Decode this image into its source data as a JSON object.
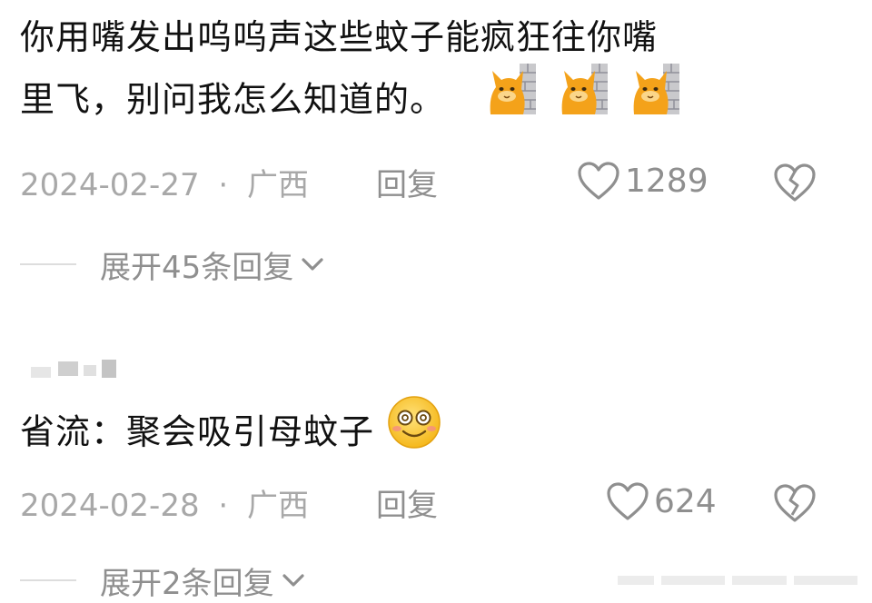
{
  "comments": [
    {
      "text_line1": "你用嘴发出呜呜声这些蚊子能疯狂往你嘴",
      "text_line2": "里飞，别问我怎么知道的。",
      "emojis": [
        "cat-peeking-wall-icon",
        "cat-peeking-wall-icon",
        "cat-peeking-wall-icon"
      ],
      "date": "2024-02-27",
      "separator": "·",
      "location": "广西",
      "reply_label": "回复",
      "like_count": "1289",
      "expand_label": "展开45条回复"
    },
    {
      "text": "省流：聚会吸引母蚊子",
      "emojis": [
        "blushing-smile-emoji-icon"
      ],
      "date": "2024-02-28",
      "separator": "·",
      "location": "广西",
      "reply_label": "回复",
      "like_count": "624",
      "expand_label": "展开2条回复"
    }
  ],
  "colors": {
    "primary_text": "#111111",
    "meta_text": "#a8a8a8",
    "icon_gray": "#8f8f8f",
    "divider": "#dddddd"
  }
}
